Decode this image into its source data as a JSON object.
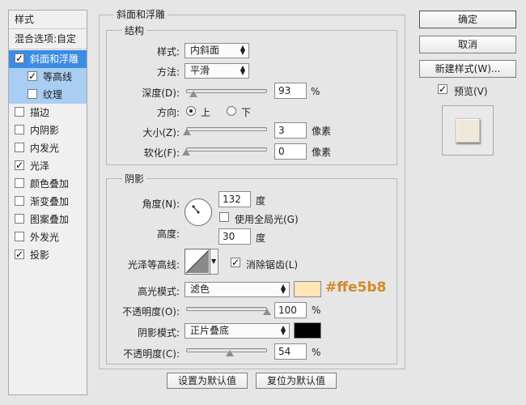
{
  "style_list": {
    "title": "样式",
    "blend_options": "混合选项:自定",
    "items": [
      {
        "label": "斜面和浮雕",
        "checked": true
      },
      {
        "label": "等高线",
        "checked": true
      },
      {
        "label": "纹理",
        "checked": false
      },
      {
        "label": "描边",
        "checked": false
      },
      {
        "label": "内阴影",
        "checked": false
      },
      {
        "label": "内发光",
        "checked": false
      },
      {
        "label": "光泽",
        "checked": true
      },
      {
        "label": "颜色叠加",
        "checked": false
      },
      {
        "label": "渐变叠加",
        "checked": false
      },
      {
        "label": "图案叠加",
        "checked": false
      },
      {
        "label": "外发光",
        "checked": false
      },
      {
        "label": "投影",
        "checked": true
      }
    ]
  },
  "panel": {
    "title": "斜面和浮雕",
    "structure": {
      "title": "结构",
      "style_label": "样式:",
      "style_value": "内斜面",
      "technique_label": "方法:",
      "technique_value": "平滑",
      "depth_label": "深度(D):",
      "depth_value": "93",
      "depth_unit": "%",
      "depth_level": 0.093,
      "direction_label": "方向:",
      "direction_up": "上",
      "direction_down": "下",
      "direction_selected": "上",
      "size_label": "大小(Z):",
      "size_value": "3",
      "size_unit": "像素",
      "size_level": 0.012,
      "soften_label": "软化(F):",
      "soften_value": "0",
      "soften_unit": "像素",
      "soften_level": 0.0
    },
    "shading": {
      "title": "阴影",
      "angle_label": "角度(N):",
      "angle_value": "132",
      "angle_unit": "度",
      "global_light_label": "使用全局光(G)",
      "global_light_checked": false,
      "altitude_label": "高度:",
      "altitude_value": "30",
      "altitude_unit": "度",
      "gloss_contour_label": "光泽等高线:",
      "anti_alias_label": "消除锯齿(L)",
      "anti_alias_checked": true,
      "highlight_mode_label": "高光模式:",
      "highlight_mode_value": "滤色",
      "highlight_color": "#ffe5b8",
      "highlight_color_text": "#ffe5b8",
      "highlight_opacity_label": "不透明度(O):",
      "highlight_opacity_value": "100",
      "highlight_opacity_unit": "%",
      "highlight_opacity_level": 1.0,
      "shadow_mode_label": "阴影模式:",
      "shadow_mode_value": "正片叠底",
      "shadow_color": "#000000",
      "shadow_opacity_label": "不透明度(C):",
      "shadow_opacity_value": "54",
      "shadow_opacity_unit": "%",
      "shadow_opacity_level": 0.54
    },
    "make_default": "设置为默认值",
    "reset_default": "复位为默认值"
  },
  "actions": {
    "ok": "确定",
    "cancel": "取消",
    "new_style": "新建样式(W)...",
    "preview_label": "预览(V)",
    "preview_checked": true
  },
  "colors": {
    "selection": "#3b8ce2",
    "sub_selection": "#a9cdf3",
    "hex_annotation": "#d4892a"
  }
}
